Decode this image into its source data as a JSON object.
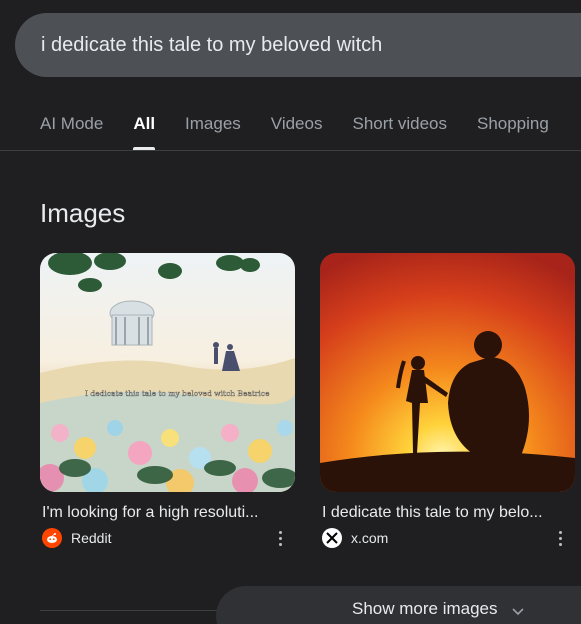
{
  "search": {
    "query": "i dedicate this tale to my beloved witch"
  },
  "tabs": [
    {
      "label": "AI Mode",
      "active": false
    },
    {
      "label": "All",
      "active": true
    },
    {
      "label": "Images",
      "active": false
    },
    {
      "label": "Videos",
      "active": false
    },
    {
      "label": "Short videos",
      "active": false
    },
    {
      "label": "Shopping",
      "active": false
    }
  ],
  "images_section": {
    "title": "Images",
    "results": [
      {
        "caption": "I'm looking for a high resoluti...",
        "source": "Reddit",
        "source_icon": "reddit-icon",
        "overlay_text": "I dedicate this tale to my beloved witch Beatrice"
      },
      {
        "caption": "I dedicate this tale to my belo...",
        "source": "x.com",
        "source_icon": "x-icon"
      }
    ]
  },
  "show_more": {
    "label": "Show more images"
  },
  "colors": {
    "background": "#1f1f22",
    "searchbar": "#4d5156",
    "text": "#e8eaed",
    "muted": "#9aa0a6",
    "reddit": "#ff4500"
  }
}
